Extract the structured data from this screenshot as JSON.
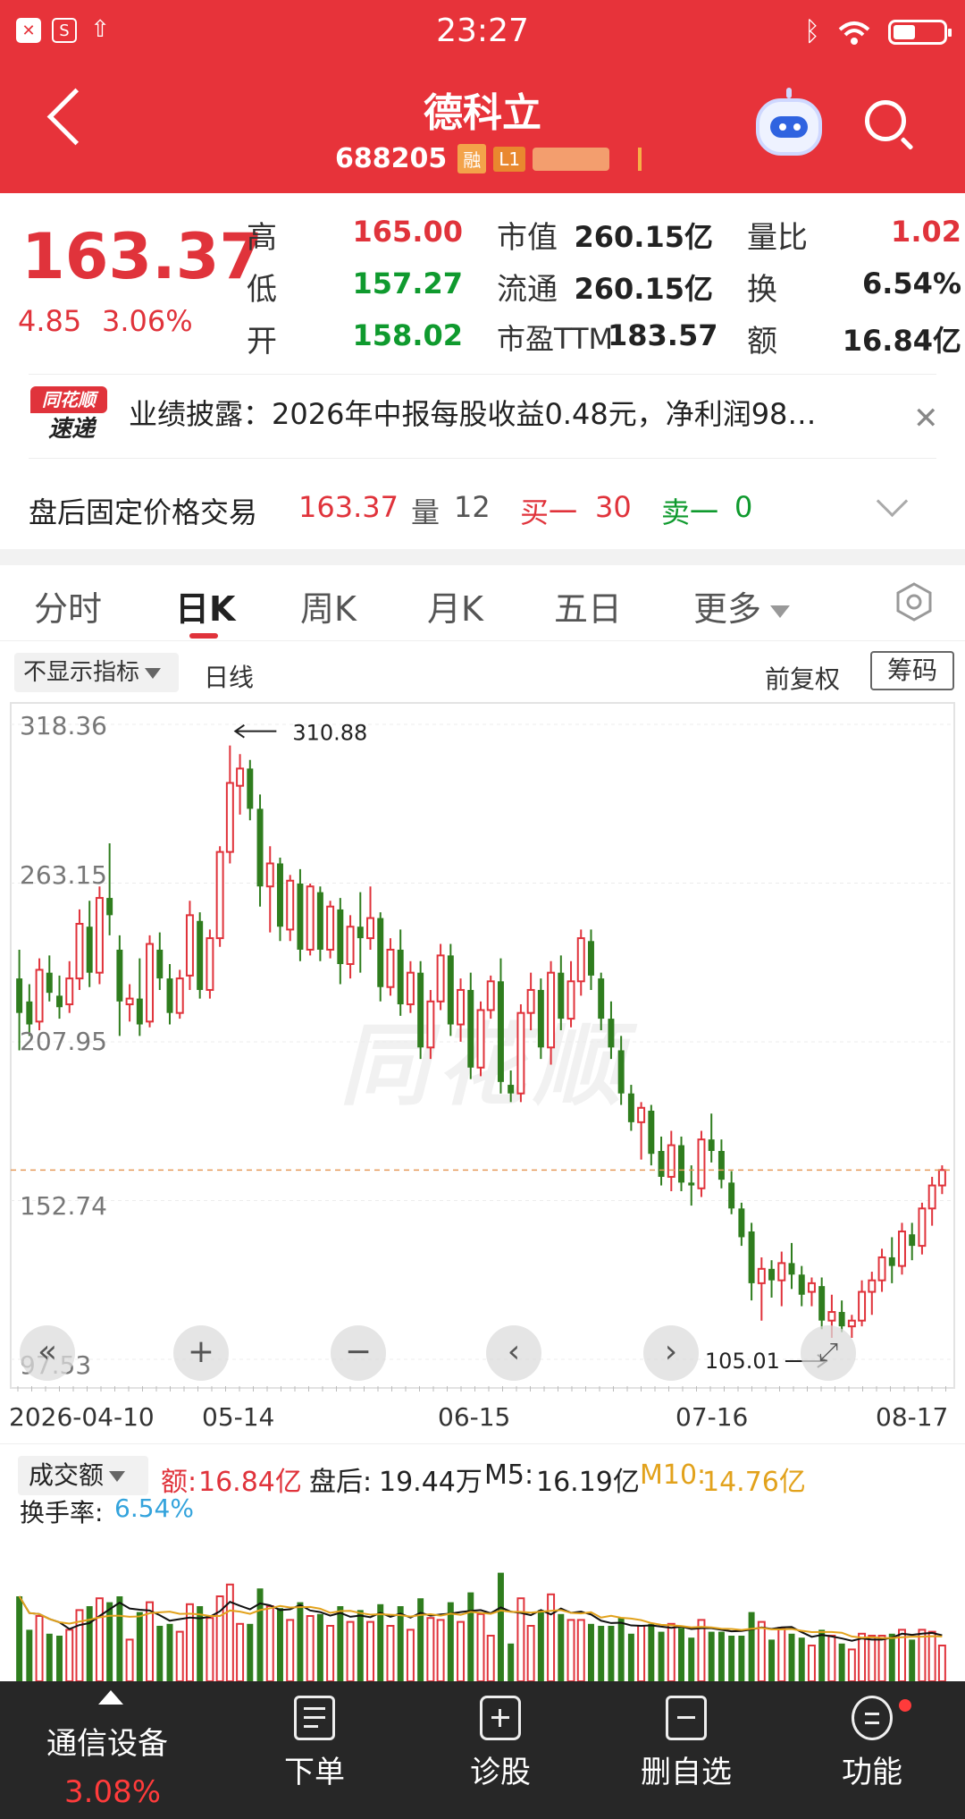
{
  "status": {
    "time": "23:27"
  },
  "stock": {
    "name": "德科立",
    "code": "688205",
    "tag_margin": "融",
    "tag_level": "L1"
  },
  "quote": {
    "price": "163.37",
    "change": "4.85",
    "change_pct": "3.06%",
    "high_label": "高",
    "high": "165.00",
    "low_label": "低",
    "low": "157.27",
    "open_label": "开",
    "open": "158.02",
    "mcap_label": "市值",
    "mcap": "260.15亿",
    "float_label": "流通",
    "float": "260.15亿",
    "pe_label": "市盈TTM",
    "pe": "183.57",
    "vr_label": "量比",
    "vr": "1.02",
    "turnover_label": "换",
    "turnover": "6.54%",
    "amount_label": "额",
    "amount": "16.84亿"
  },
  "news": {
    "logo_top": "同花顺",
    "logo_bottom": "速递",
    "text": "业绩披露：2026年中报每股收益0.48元，净利润98…",
    "close": "✕"
  },
  "after_hours": {
    "label": "盘后固定价格交易",
    "price": "163.37",
    "vol_label": "量",
    "vol": "12",
    "buy1_label": "买一",
    "buy1": "30",
    "sell1_label": "卖一",
    "sell1": "0"
  },
  "tabs": [
    "分时",
    "日K",
    "周K",
    "月K",
    "五日",
    "更多"
  ],
  "indicator": {
    "label": "不显示指标",
    "line": "日线",
    "adjust": "前复权",
    "chips": "筹码"
  },
  "chart_data": {
    "type": "candlestick",
    "y_ticks": [
      "318.36",
      "263.15",
      "207.95",
      "152.74",
      "97.53"
    ],
    "ylim": [
      97.53,
      318.36
    ],
    "x_labels": [
      "2026-04-10",
      "05-14",
      "06-15",
      "07-16",
      "08-17"
    ],
    "max_annotation": "310.88",
    "min_annotation": "105.01",
    "last_close": 163.37,
    "candles": [
      [
        230,
        240,
        205,
        218
      ],
      [
        222,
        228,
        210,
        214
      ],
      [
        215,
        237,
        212,
        233
      ],
      [
        232,
        238,
        222,
        225
      ],
      [
        224,
        231,
        216,
        220
      ],
      [
        221,
        236,
        218,
        230
      ],
      [
        230,
        254,
        226,
        249
      ],
      [
        248,
        257,
        227,
        232
      ],
      [
        232,
        262,
        228,
        258
      ],
      [
        258,
        277,
        245,
        252
      ],
      [
        240,
        245,
        210,
        222
      ],
      [
        221,
        228,
        215,
        223
      ],
      [
        223,
        237,
        210,
        214
      ],
      [
        215,
        245,
        213,
        242
      ],
      [
        240,
        246,
        226,
        230
      ],
      [
        230,
        235,
        214,
        218
      ],
      [
        218,
        233,
        216,
        230
      ],
      [
        231,
        257,
        226,
        252
      ],
      [
        250,
        253,
        223,
        226
      ],
      [
        226,
        247,
        223,
        244
      ],
      [
        244,
        276,
        241,
        274
      ],
      [
        274,
        311,
        270,
        298
      ],
      [
        297,
        308,
        287,
        303
      ],
      [
        303,
        306,
        285,
        289
      ],
      [
        289,
        294,
        255,
        262
      ],
      [
        262,
        276,
        246,
        270
      ],
      [
        270,
        272,
        243,
        248
      ],
      [
        247,
        266,
        243,
        264
      ],
      [
        263,
        268,
        236,
        240
      ],
      [
        240,
        263,
        238,
        262
      ],
      [
        260,
        262,
        236,
        240
      ],
      [
        240,
        257,
        237,
        255
      ],
      [
        254,
        258,
        228,
        235
      ],
      [
        235,
        252,
        230,
        248
      ],
      [
        248,
        260,
        232,
        244
      ],
      [
        244,
        262,
        240,
        251
      ],
      [
        251,
        253,
        222,
        227
      ],
      [
        227,
        244,
        224,
        240
      ],
      [
        240,
        247,
        217,
        221
      ],
      [
        221,
        236,
        218,
        232
      ],
      [
        232,
        236,
        202,
        206
      ],
      [
        206,
        226,
        202,
        222
      ],
      [
        222,
        242,
        219,
        238
      ],
      [
        238,
        242,
        210,
        214
      ],
      [
        214,
        230,
        208,
        226
      ],
      [
        226,
        232,
        195,
        199
      ],
      [
        199,
        222,
        196,
        219
      ],
      [
        219,
        231,
        216,
        229
      ],
      [
        229,
        237,
        190,
        194
      ],
      [
        193,
        198,
        187,
        190
      ],
      [
        190,
        221,
        187,
        218
      ],
      [
        218,
        232,
        212,
        226
      ],
      [
        226,
        230,
        202,
        206
      ],
      [
        206,
        236,
        200,
        232
      ],
      [
        232,
        238,
        212,
        216
      ],
      [
        216,
        236,
        213,
        229
      ],
      [
        229,
        247,
        224,
        244
      ],
      [
        243,
        247,
        226,
        231
      ],
      [
        230,
        232,
        212,
        216
      ],
      [
        216,
        222,
        202,
        206
      ],
      [
        205,
        210,
        186,
        190
      ],
      [
        190,
        193,
        177,
        180
      ],
      [
        180,
        187,
        167,
        185
      ],
      [
        184,
        186,
        165,
        169
      ],
      [
        170,
        175,
        158,
        161
      ],
      [
        161,
        177,
        156,
        172
      ],
      [
        172,
        175,
        156,
        159
      ],
      [
        159,
        165,
        151,
        158
      ],
      [
        157,
        177,
        154,
        174
      ],
      [
        174,
        183,
        166,
        170
      ],
      [
        170,
        174,
        157,
        160
      ],
      [
        159,
        163,
        148,
        150
      ],
      [
        150,
        152,
        137,
        140
      ],
      [
        142,
        145,
        118,
        124
      ],
      [
        124,
        133,
        111,
        129
      ],
      [
        129,
        132,
        119,
        125
      ],
      [
        125,
        135,
        116,
        131
      ],
      [
        131,
        138,
        122,
        127
      ],
      [
        127,
        130,
        116,
        120
      ],
      [
        121,
        126,
        116,
        124
      ],
      [
        123,
        126,
        108,
        111
      ],
      [
        111,
        120,
        105,
        114
      ],
      [
        114,
        118,
        107,
        109
      ],
      [
        109,
        113,
        105,
        111
      ],
      [
        111,
        125,
        109,
        121
      ],
      [
        121,
        128,
        113,
        125
      ],
      [
        125,
        136,
        121,
        133
      ],
      [
        133,
        140,
        124,
        130
      ],
      [
        130,
        145,
        127,
        142
      ],
      [
        141,
        145,
        132,
        137
      ],
      [
        137,
        152,
        134,
        150
      ],
      [
        150,
        161,
        144,
        158
      ],
      [
        158,
        165,
        155,
        163.37
      ]
    ]
  },
  "volume": {
    "dropdown": "成交额",
    "amount_label": "额:",
    "amount": "16.84亿",
    "after_label": "盘后:",
    "after": "19.44万",
    "m5_label": "M5:",
    "m5": "16.19亿",
    "m10_label": "M10:",
    "m10": "14.76亿",
    "turnover_label": "换手率:",
    "turnover": "6.54%"
  },
  "bottom": {
    "industry": "通信设备",
    "industry_pct": "3.08%",
    "items": [
      "下单",
      "诊股",
      "删自选",
      "功能"
    ]
  }
}
